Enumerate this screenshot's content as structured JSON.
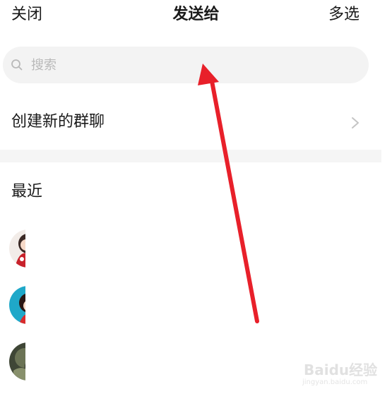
{
  "header": {
    "close_label": "关闭",
    "title": "发送给",
    "multi_select_label": "多选"
  },
  "search": {
    "placeholder": "搜索",
    "value": ""
  },
  "create_group": {
    "label": "创建新的群聊"
  },
  "recent": {
    "section_title": "最近",
    "contacts": [
      {
        "avatar": "avatar-girl-red-dress"
      },
      {
        "avatar": "avatar-girl-blue-background"
      },
      {
        "avatar": "avatar-dark-green"
      }
    ]
  },
  "annotation": {
    "arrow_color": "#e8202a"
  },
  "watermark": {
    "text": "Baidu经验",
    "subtext": "jingyan.baidu.com"
  },
  "colors": {
    "search_background": "#f3f3f3",
    "divider": "#f5f5f5",
    "placeholder": "#b9b9b9"
  }
}
